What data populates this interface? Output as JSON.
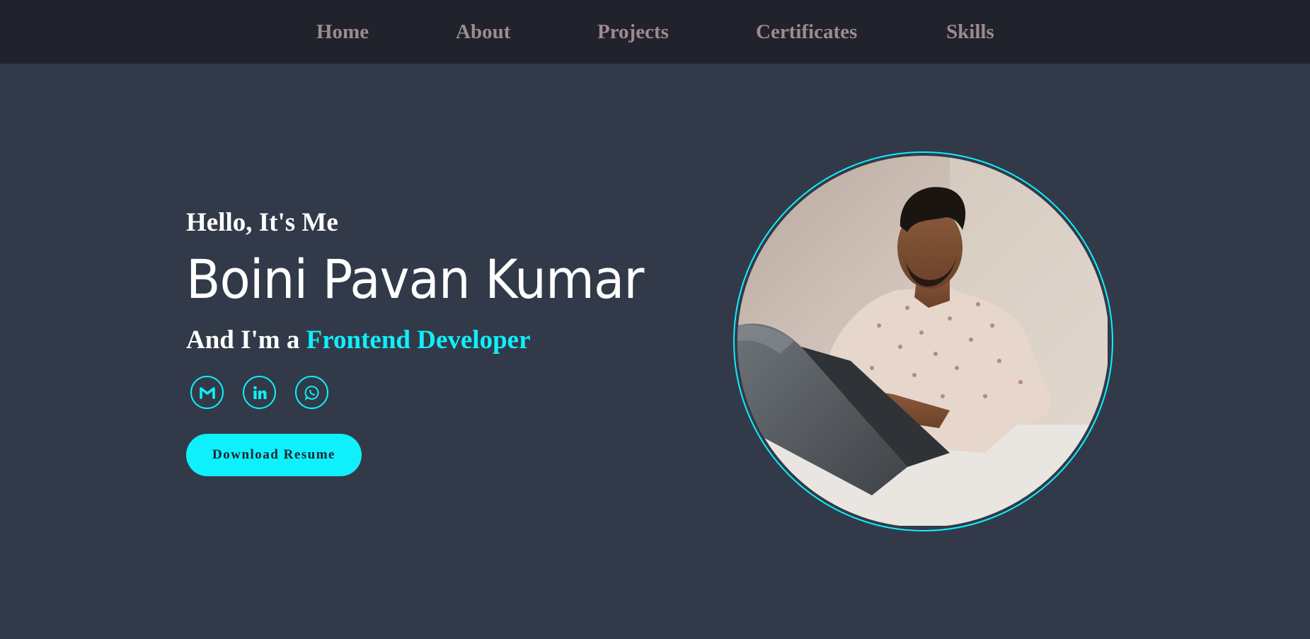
{
  "nav": {
    "items": [
      {
        "label": "Home"
      },
      {
        "label": "About"
      },
      {
        "label": "Projects"
      },
      {
        "label": "Certificates"
      },
      {
        "label": "Skills"
      }
    ]
  },
  "hero": {
    "greeting": "Hello, It's Me",
    "name": "Boini Pavan Kumar",
    "role_prefix": "And I'm a ",
    "role": "Frontend Developer",
    "social": [
      {
        "icon": "gmail-icon"
      },
      {
        "icon": "linkedin-icon"
      },
      {
        "icon": "whatsapp-icon"
      }
    ],
    "resume_label": "Download Resume",
    "photo_icon": "profile-photo"
  },
  "colors": {
    "background": "#323a49",
    "navbar": "#20232c",
    "nav_text": "#9e8a8e",
    "accent": "#0ef0fc",
    "text": "#ffffff"
  }
}
